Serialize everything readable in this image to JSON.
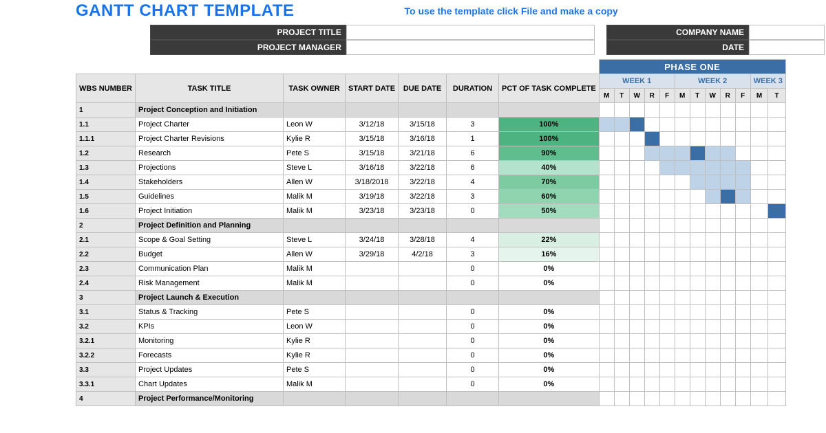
{
  "header": {
    "title": "GANTT CHART TEMPLATE",
    "instruction": "To use the template click File and make a copy"
  },
  "meta": {
    "project_title_label": "PROJECT TITLE",
    "project_manager_label": "PROJECT MANAGER",
    "company_label": "COMPANY NAME",
    "date_label": "DATE"
  },
  "gantt": {
    "phase_label": "PHASE ONE",
    "weeks": [
      "WEEK 1",
      "WEEK 2",
      "WEEK 3"
    ],
    "days": [
      "M",
      "T",
      "W",
      "R",
      "F",
      "M",
      "T",
      "W",
      "R",
      "F",
      "M",
      "T"
    ],
    "cols": {
      "wbs": "WBS NUMBER",
      "title": "TASK TITLE",
      "owner": "TASK OWNER",
      "start": "START DATE",
      "due": "DUE DATE",
      "dur": "DURATION",
      "pct": "PCT OF TASK COMPLETE"
    }
  },
  "rows": [
    {
      "type": "section",
      "wbs": "1",
      "title": "Project Conception and Initiation"
    },
    {
      "type": "task",
      "wbs": "1.1",
      "title": "Project Charter",
      "owner": "Leon W",
      "start": "3/12/18",
      "due": "3/15/18",
      "dur": "3",
      "pct": "100%",
      "pctColor": "#4db380",
      "bar": {
        "from": 0,
        "to": 3,
        "dark": 2
      }
    },
    {
      "type": "task",
      "wbs": "1.1.1",
      "title": "Project Charter Revisions",
      "owner": "Kylie R",
      "start": "3/15/18",
      "due": "3/16/18",
      "dur": "1",
      "pct": "100%",
      "pctColor": "#4db380",
      "bar": {
        "from": 3,
        "to": 4,
        "dark": 3
      }
    },
    {
      "type": "task",
      "wbs": "1.2",
      "title": "Research",
      "owner": "Pete S",
      "start": "3/15/18",
      "due": "3/21/18",
      "dur": "6",
      "pct": "90%",
      "pctColor": "#5fbd8e",
      "bar": {
        "from": 3,
        "to": 9,
        "dark": 6
      }
    },
    {
      "type": "task",
      "wbs": "1.3",
      "title": "Projections",
      "owner": "Steve L",
      "start": "3/16/18",
      "due": "3/22/18",
      "dur": "6",
      "pct": "40%",
      "pctColor": "#b5e2cd",
      "bar": {
        "from": 4,
        "to": 10
      }
    },
    {
      "type": "task",
      "wbs": "1.4",
      "title": "Stakeholders",
      "owner": "Allen W",
      "start": "3/18/2018",
      "due": "3/22/18",
      "dur": "4",
      "pct": "70%",
      "pctColor": "#7dcba1",
      "bar": {
        "from": 6,
        "to": 10
      }
    },
    {
      "type": "task",
      "wbs": "1.5",
      "title": "Guidelines",
      "owner": "Malik M",
      "start": "3/19/18",
      "due": "3/22/18",
      "dur": "3",
      "pct": "60%",
      "pctColor": "#8fd3af",
      "bar": {
        "from": 7,
        "to": 10,
        "dark": 8
      }
    },
    {
      "type": "task",
      "wbs": "1.6",
      "title": "Project Initiation",
      "owner": "Malik M",
      "start": "3/23/18",
      "due": "3/23/18",
      "dur": "0",
      "pct": "50%",
      "pctColor": "#a2dbbd",
      "bar": {
        "from": 11,
        "to": 12,
        "dark": 11
      }
    },
    {
      "type": "section",
      "wbs": "2",
      "title": "Project Definition and Planning"
    },
    {
      "type": "task",
      "wbs": "2.1",
      "title": "Scope & Goal Setting",
      "owner": "Steve L",
      "start": "3/24/18",
      "due": "3/28/18",
      "dur": "4",
      "pct": "22%",
      "pctColor": "#d9efe3"
    },
    {
      "type": "task",
      "wbs": "2.2",
      "title": "Budget",
      "owner": "Allen W",
      "start": "3/29/18",
      "due": "4/2/18",
      "dur": "3",
      "pct": "16%",
      "pctColor": "#e5f4ec"
    },
    {
      "type": "task",
      "wbs": "2.3",
      "title": "Communication Plan",
      "owner": "Malik M",
      "start": "",
      "due": "",
      "dur": "0",
      "pct": "0%",
      "pctColor": "#ffffff"
    },
    {
      "type": "task",
      "wbs": "2.4",
      "title": "Risk Management",
      "owner": "Malik M",
      "start": "",
      "due": "",
      "dur": "0",
      "pct": "0%",
      "pctColor": "#ffffff"
    },
    {
      "type": "section",
      "wbs": "3",
      "title": "Project Launch & Execution"
    },
    {
      "type": "task",
      "wbs": "3.1",
      "title": "Status & Tracking",
      "owner": "Pete S",
      "start": "",
      "due": "",
      "dur": "0",
      "pct": "0%",
      "pctColor": "#ffffff"
    },
    {
      "type": "task",
      "wbs": "3.2",
      "title": "KPIs",
      "owner": "Leon W",
      "start": "",
      "due": "",
      "dur": "0",
      "pct": "0%",
      "pctColor": "#ffffff"
    },
    {
      "type": "task",
      "wbs": "3.2.1",
      "title": "Monitoring",
      "owner": "Kylie R",
      "start": "",
      "due": "",
      "dur": "0",
      "pct": "0%",
      "pctColor": "#ffffff"
    },
    {
      "type": "task",
      "wbs": "3.2.2",
      "title": "Forecasts",
      "owner": "Kylie R",
      "start": "",
      "due": "",
      "dur": "0",
      "pct": "0%",
      "pctColor": "#ffffff"
    },
    {
      "type": "task",
      "wbs": "3.3",
      "title": "Project Updates",
      "owner": "Pete S",
      "start": "",
      "due": "",
      "dur": "0",
      "pct": "0%",
      "pctColor": "#ffffff"
    },
    {
      "type": "task",
      "wbs": "3.3.1",
      "title": "Chart Updates",
      "owner": "Malik M",
      "start": "",
      "due": "",
      "dur": "0",
      "pct": "0%",
      "pctColor": "#ffffff"
    },
    {
      "type": "section",
      "wbs": "4",
      "title": "Project Performance/Monitoring"
    }
  ]
}
